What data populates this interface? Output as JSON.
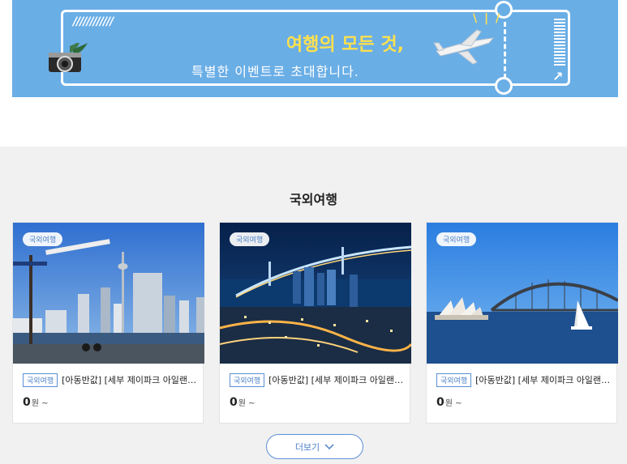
{
  "banner": {
    "title": "여행의 모든 것,",
    "subtitle": "특별한 이벤트로 초대합니다.",
    "slashes": "////////////",
    "arrow": "↗"
  },
  "section": {
    "title": "국외여행"
  },
  "cards": [
    {
      "badge": "국외여행",
      "tag": "국외여행",
      "name": "[아동반값] [세부 제이파크 아일랜드 리조트]",
      "price": "0",
      "unit": "원 ~"
    },
    {
      "badge": "국외여행",
      "tag": "국외여행",
      "name": "[아동반값] [세부 제이파크 아일랜드 리조트]",
      "price": "0",
      "unit": "원 ~"
    },
    {
      "badge": "국외여행",
      "tag": "국외여행",
      "name": "[아동반값] [세부 제이파크 아일랜드 리조트]",
      "price": "0",
      "unit": "원 ~"
    }
  ],
  "more_button": {
    "label": "더보기"
  },
  "colors": {
    "banner_bg": "#6aaee6",
    "title_yellow": "#ffe14d",
    "accent_blue": "#4a7fc8",
    "section_bg": "#f1f1f1"
  }
}
